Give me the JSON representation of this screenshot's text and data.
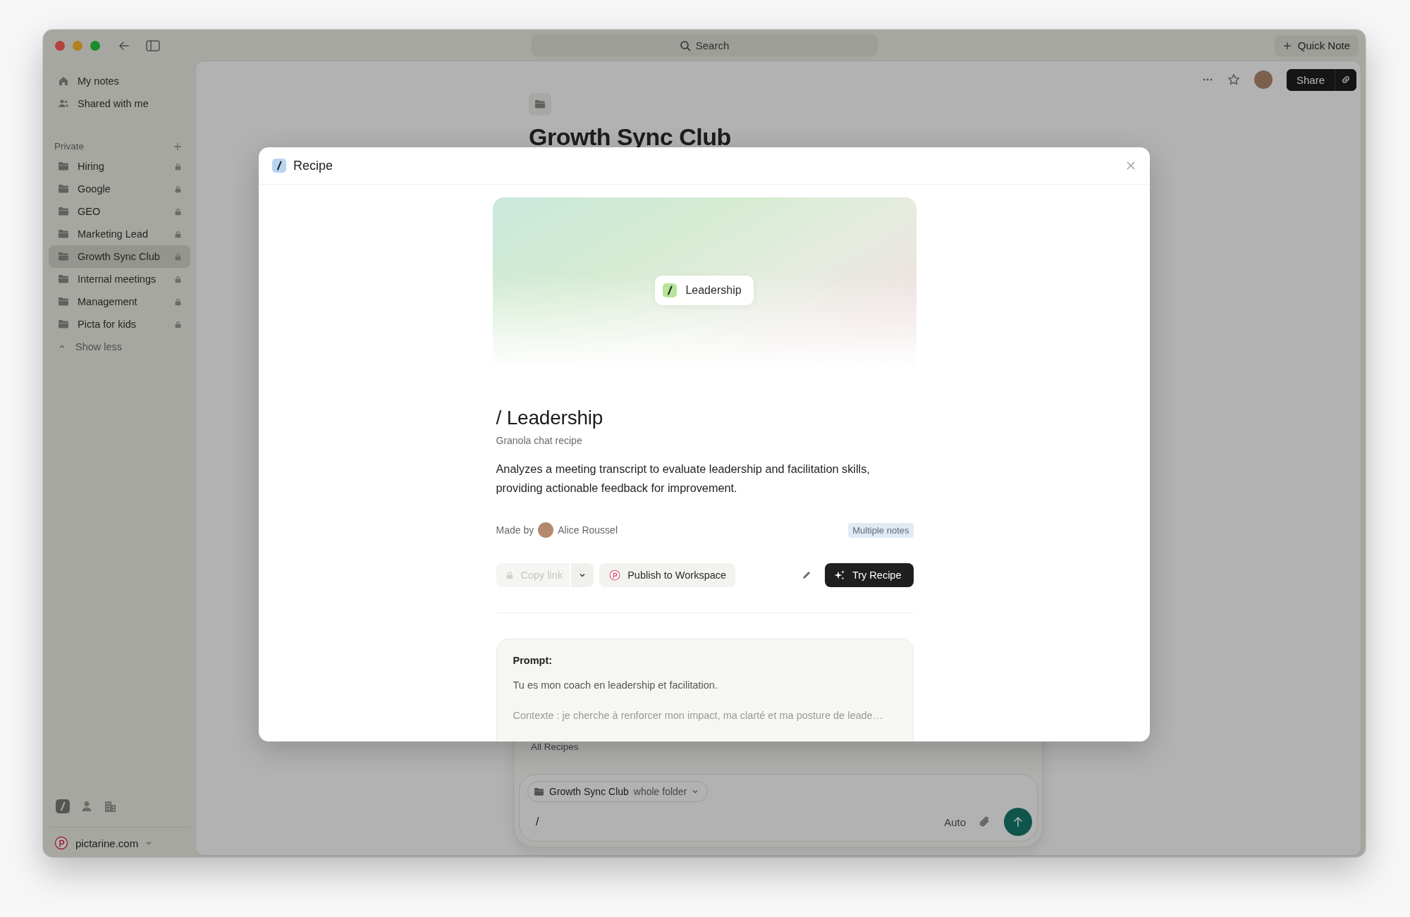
{
  "toolbar": {
    "search_placeholder": "Search",
    "quick_note": "Quick Note"
  },
  "sidebar": {
    "top_items": [
      {
        "kind": "home",
        "label": "My notes"
      },
      {
        "kind": "people",
        "label": "Shared with me"
      }
    ],
    "section_title": "Private",
    "folders": [
      {
        "label": "Hiring",
        "selected": false,
        "locked": true
      },
      {
        "label": "Google",
        "selected": false,
        "locked": true
      },
      {
        "label": "GEO",
        "selected": false,
        "locked": true
      },
      {
        "label": "Marketing Lead",
        "selected": false,
        "locked": true
      },
      {
        "label": "Growth Sync Club",
        "selected": true,
        "locked": true
      },
      {
        "label": "Internal meetings",
        "selected": false,
        "locked": true
      },
      {
        "label": "Management",
        "selected": false,
        "locked": true
      },
      {
        "label": "Picta for kids",
        "selected": false,
        "locked": true
      }
    ],
    "toggle": "Show less",
    "footer_tools": [
      {
        "kind": "recipes",
        "selected": true
      },
      {
        "kind": "person",
        "selected": false
      },
      {
        "kind": "building",
        "selected": false
      }
    ],
    "workspace": "pictarine.com"
  },
  "note": {
    "title": "Growth Sync Club",
    "share": "Share"
  },
  "chat": {
    "recipes_link": "All Recipes",
    "scope_folder": "Growth Sync Club",
    "scope_detail": "whole folder",
    "input_value": "/",
    "model": "Auto"
  },
  "modal": {
    "title": "Recipe",
    "hero_pill": "Leadership",
    "heading": "/ Leadership",
    "subtitle": "Granola chat recipe",
    "description": "Analyzes a meeting transcript to evaluate leadership and facilitation skills, providing actionable feedback for improvement.",
    "made_by_label": "Made by",
    "author": "Alice Roussel",
    "scope_tag": "Multiple notes",
    "buttons": [
      {
        "kind": "copy",
        "label": "Copy link",
        "disabled": true
      },
      {
        "kind": "publish",
        "label": "Publish to Workspace",
        "disabled": false
      },
      {
        "kind": "try",
        "label": "Try Recipe",
        "disabled": false
      }
    ],
    "prompt": {
      "label": "Prompt:",
      "lines": [
        "Tu es mon coach en leadership et facilitation.",
        "Contexte : je cherche à renforcer mon impact, ma clarté et ma posture de leade…"
      ]
    }
  }
}
